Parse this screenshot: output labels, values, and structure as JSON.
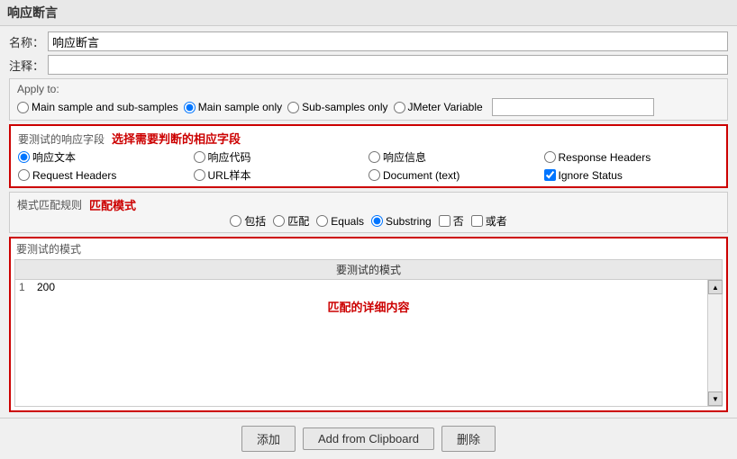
{
  "panel": {
    "title": "响应断言"
  },
  "name_field": {
    "label": "名称：",
    "value": "响应断言"
  },
  "comment_field": {
    "label": "注释："
  },
  "apply_to": {
    "section_label": "Apply to:",
    "options": [
      {
        "id": "apply-main-sub",
        "label": "Main sample and sub-samples",
        "checked": false
      },
      {
        "id": "apply-main-only",
        "label": "Main sample only",
        "checked": true
      },
      {
        "id": "apply-sub-only",
        "label": "Sub-samples only",
        "checked": false
      },
      {
        "id": "apply-jmeter",
        "label": "JMeter Variable",
        "checked": false
      }
    ]
  },
  "field_to_test": {
    "section_label": "要测试的响应字段",
    "hint": "选择需要判断的相应字段",
    "options": [
      {
        "id": "field-response-text",
        "label": "响应文本",
        "checked": true
      },
      {
        "id": "field-response-code",
        "label": "响应代码",
        "checked": false
      },
      {
        "id": "field-response-info",
        "label": "响应信息",
        "checked": false
      },
      {
        "id": "field-response-headers",
        "label": "Response Headers",
        "checked": false
      },
      {
        "id": "field-request-headers",
        "label": "Request Headers",
        "checked": false
      },
      {
        "id": "field-url",
        "label": "URL样本",
        "checked": false
      },
      {
        "id": "field-document",
        "label": "Document (text)",
        "checked": false
      },
      {
        "id": "field-ignore-status",
        "label": "Ignore Status",
        "checked": true,
        "type": "checkbox"
      }
    ]
  },
  "pattern_match": {
    "section_label": "模式匹配规则",
    "hint": "匹配模式",
    "options": [
      {
        "id": "match-contains",
        "label": "包括",
        "checked": false
      },
      {
        "id": "match-matches",
        "label": "匹配",
        "checked": false
      },
      {
        "id": "match-equals",
        "label": "Equals",
        "checked": false
      },
      {
        "id": "match-substring",
        "label": "Substring",
        "checked": true
      },
      {
        "id": "match-not",
        "label": "否",
        "checked": false,
        "type": "checkbox"
      },
      {
        "id": "match-or",
        "label": "或者",
        "checked": false,
        "type": "checkbox"
      }
    ]
  },
  "test_patterns": {
    "section_label": "要测试的模式",
    "table_header": "要测试的模式",
    "hint": "匹配的详细内容",
    "rows": [
      {
        "num": "1",
        "value": "200"
      }
    ]
  },
  "buttons": {
    "add": "添加",
    "add_clipboard": "Add from Clipboard",
    "delete": "删除"
  }
}
